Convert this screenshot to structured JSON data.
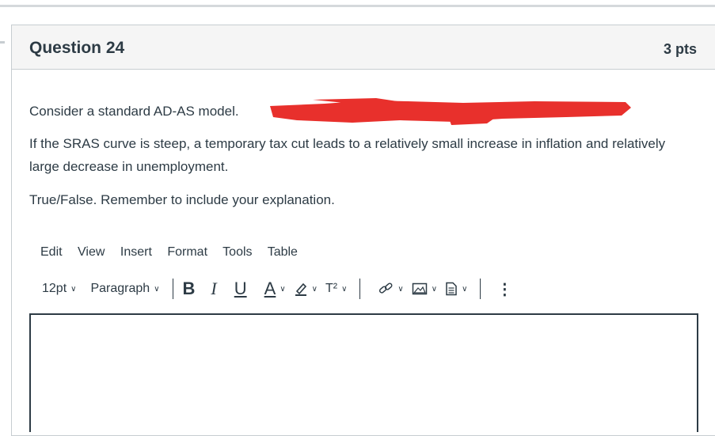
{
  "question": {
    "title": "Question 24",
    "points": "3 pts",
    "line1": "Consider a standard AD-AS model.",
    "line2": "If the SRAS curve is steep, a temporary tax cut leads to a relatively small increase in inflation and relatively large decrease in unemployment.",
    "line3": "True/False. Remember to include your explanation."
  },
  "menu": [
    "Edit",
    "View",
    "Insert",
    "Format",
    "Tools",
    "Table"
  ],
  "toolbar": {
    "font_size": "12pt",
    "block_format": "Paragraph",
    "bold": "B",
    "italic": "I",
    "underline": "U",
    "text_color": "A",
    "superscript": "T²"
  },
  "colors": {
    "redaction": "#e8302c",
    "text": "#2d3b45",
    "header_bg": "#f5f5f5"
  }
}
